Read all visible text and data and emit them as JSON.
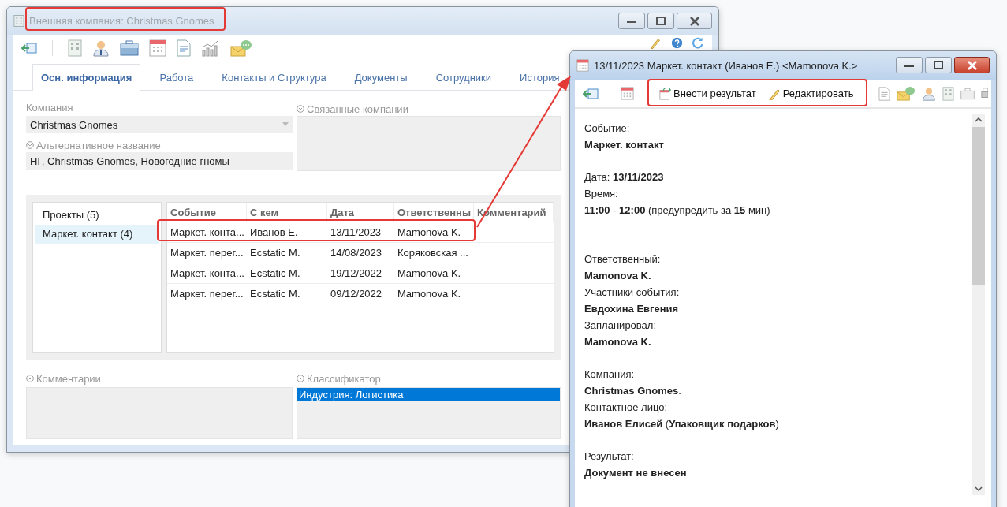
{
  "company_window": {
    "title": "Внешняя компания: Christmas Gnomes",
    "tabs": [
      {
        "label": "Осн. информация",
        "selected": true
      },
      {
        "label": "Работа",
        "selected": false
      },
      {
        "label": "Контакты и Структура",
        "selected": false
      },
      {
        "label": "Документы",
        "selected": false
      },
      {
        "label": "Сотрудники",
        "selected": false
      },
      {
        "label": "История",
        "selected": false
      }
    ],
    "company_label": "Компания",
    "company_value": "Christmas Gnomes",
    "alt_name_label": "Альтернативное название",
    "alt_name_value": "НГ, Christmas Gnomes, Новогодние гномы",
    "related_label": "Связанные компании",
    "projects": [
      {
        "label": "Проекты (5)",
        "selected": false
      },
      {
        "label": "Маркет. контакт (4)",
        "selected": true
      }
    ],
    "table": {
      "columns": [
        "Событие",
        "С кем",
        "Дата",
        "Ответственны",
        "Комментарий"
      ],
      "rows": [
        [
          "Маркет. конта...",
          "Иванов Е.",
          "13/11/2023",
          "Mamonova K."
        ],
        [
          "Маркет. перег...",
          "Ecstatic M.",
          "14/08/2023",
          "Коряковская ..."
        ],
        [
          "Маркет. конта...",
          "Ecstatic M.",
          "19/12/2022",
          "Mamonova K."
        ],
        [
          "Маркет. перег...",
          "Ecstatic M.",
          "09/12/2022",
          "Mamonova K."
        ]
      ]
    },
    "comments_label": "Комментарии",
    "classifier_label": "Классификатор",
    "classifier_items": [
      {
        "label": "Индустрия: Логистика",
        "selected": true
      }
    ]
  },
  "event_window": {
    "title": "13/11/2023 Маркет. контакт (Иванов Е.) <Mamonova K.>",
    "actions": [
      "Внести результат",
      "Редактировать"
    ],
    "sections": [
      [
        {
          "kind": "label",
          "text": "Событие:"
        },
        {
          "kind": "value",
          "text": "Маркет. контакт"
        }
      ],
      [
        {
          "kind": "mixed",
          "text": "Дата: **13/11/2023**"
        },
        {
          "kind": "label",
          "text": "Время:"
        },
        {
          "kind": "mixed",
          "text": "**11:00** - **12:00** (предупредить за **15** мин)"
        }
      ],
      [
        {
          "kind": "label",
          "text": "Ответственный:"
        },
        {
          "kind": "value",
          "text": "Mamonova K."
        },
        {
          "kind": "label",
          "text": "Участники события:"
        },
        {
          "kind": "value",
          "text": "Евдохина Евгения"
        },
        {
          "kind": "label",
          "text": "Запланировал:"
        },
        {
          "kind": "value",
          "text": "Mamonova K."
        }
      ],
      [
        {
          "kind": "label",
          "text": "Компания:"
        },
        {
          "kind": "mixed",
          "text": "**Christmas Gnomes**."
        },
        {
          "kind": "label",
          "text": "Контактное лицо:"
        },
        {
          "kind": "mixed",
          "text": "**Иванов Елисей** (**Упаковщик подарков**)"
        }
      ],
      [
        {
          "kind": "label",
          "text": "Результат:"
        },
        {
          "kind": "value",
          "text": "Документ не внесен"
        }
      ]
    ]
  }
}
